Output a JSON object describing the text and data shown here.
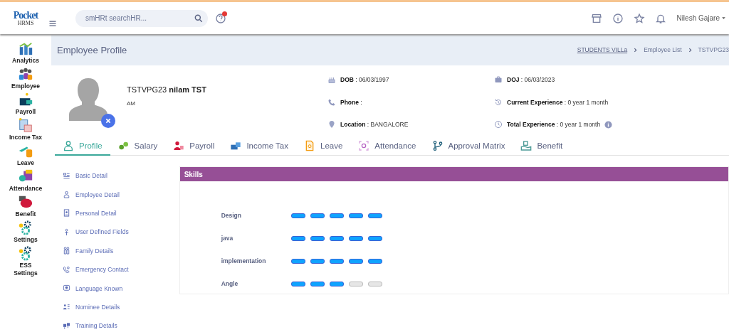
{
  "logo": {
    "word": "Pocket",
    "sub": "HRMS"
  },
  "search": {
    "placeholder": "smHRt searchHR..."
  },
  "help": {
    "has_notification": true
  },
  "user": {
    "name": "Nilesh Gajare"
  },
  "sidebar": {
    "items": [
      {
        "label": "Analytics",
        "kind": "analytics"
      },
      {
        "label": "Employee",
        "kind": "employee"
      },
      {
        "label": "Payroll",
        "kind": "payroll"
      },
      {
        "label": "Income Tax",
        "kind": "tax"
      },
      {
        "label": "Leave",
        "kind": "leave"
      },
      {
        "label": "Attendance",
        "kind": "attendance"
      },
      {
        "label": "Benefit",
        "kind": "benefit"
      },
      {
        "label": "Settings",
        "kind": "settings"
      },
      {
        "label": "ESS Settings",
        "kind": "settings"
      }
    ]
  },
  "page": {
    "title": "Employee Profile",
    "breadcrumb": [
      {
        "label": "STUDENTS VILLa",
        "kind": "link"
      },
      {
        "label": "Employee List",
        "kind": "link"
      },
      {
        "label": "TSTVPG23",
        "kind": "current"
      }
    ]
  },
  "profile": {
    "name": "TSTVPG23 **nilam TST**",
    "designation": "AM",
    "details": [
      {
        "text": "**DOB** : 06/03/1997",
        "kind": "cake"
      },
      {
        "text": "**DOJ** : 06/03/2023",
        "kind": "briefcase"
      },
      {
        "text": "**Phone** :",
        "kind": "phone"
      },
      {
        "text": "**Current Experience** : 0 year 1 month",
        "kind": "history"
      },
      {
        "text": "**Location** : BANGALORE",
        "kind": "pin"
      },
      {
        "text": "**Total Experience** : 0 year 1 month",
        "kind": "clock",
        "info": true
      }
    ]
  },
  "tabs": [
    {
      "label": "Profile",
      "selected": true,
      "kind": "person"
    },
    {
      "label": "Salary",
      "selected": false,
      "kind": "money"
    },
    {
      "label": "Payroll",
      "selected": false,
      "kind": "payroll"
    },
    {
      "label": "Income Tax",
      "selected": false,
      "kind": "tax"
    },
    {
      "label": "Leave",
      "selected": false,
      "kind": "leave"
    },
    {
      "label": "Attendance",
      "selected": false,
      "kind": "finger"
    },
    {
      "label": "Approval Matrix",
      "selected": false,
      "kind": "branch"
    },
    {
      "label": "Benefit",
      "selected": false,
      "kind": "benefit"
    }
  ],
  "sections": [
    "Basic Detail",
    "Employee Detail",
    "Personal Detail",
    "User Defined Fields",
    "Family Details",
    "Emergency Contact",
    "Language Known",
    "Nominee Details",
    "Training Details"
  ],
  "skills": {
    "title": "Skills",
    "rows": [
      {
        "name": "Design",
        "stars": 5
      },
      {
        "name": "java",
        "stars": 5
      },
      {
        "name": "implementation",
        "stars": 5
      },
      {
        "name": "Angle",
        "stars": 3
      }
    ]
  }
}
